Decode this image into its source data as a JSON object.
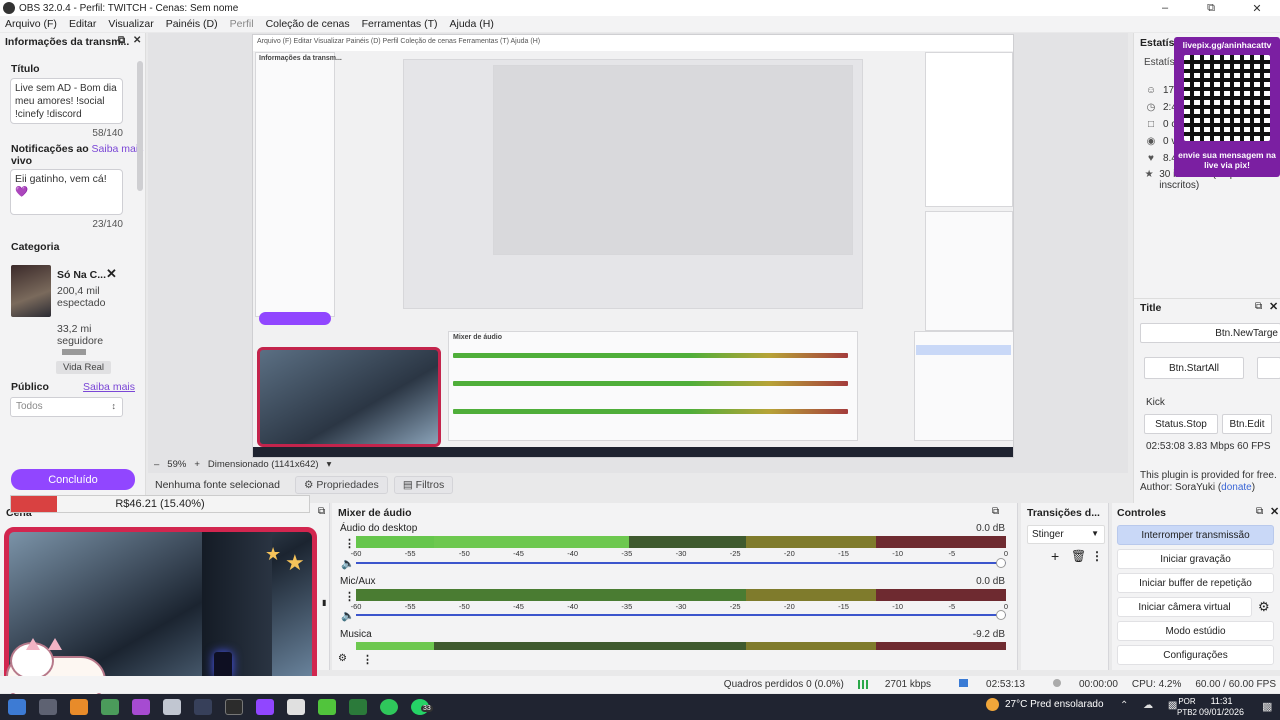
{
  "window": {
    "title": "OBS 32.0.4 - Perfil: TWITCH - Cenas: Sem nome"
  },
  "menu": [
    "Arquivo (F)",
    "Editar",
    "Visualizar",
    "Painéis (D)",
    "Perfil",
    "Coleção de cenas",
    "Ferramentas (T)",
    "Ajuda (H)"
  ],
  "left_dock": {
    "title": "Informações da transm...",
    "titulo_label": "Título",
    "titulo_value": "Live sem AD - Bom dia meu amores! !social !cinefy !discord",
    "titulo_count": "58/140",
    "notif_label": "Notificações ao",
    "notif_label2": "vivo",
    "notif_link": "Saiba mais",
    "notif_value": "Eii gatinho, vem cá! 💜",
    "notif_count": "23/140",
    "categoria_label": "Categoria",
    "cat_name": "Só Na C...",
    "cat_viewers": "200,4 mil",
    "cat_viewers_label": "espectado",
    "cat_followers": "33,2 mi",
    "cat_followers_label": "seguidore",
    "cat_tag": "Vida Real",
    "publico_label": "Público",
    "publico_link": "Saiba mais",
    "publico_value": "Todos",
    "done_label": "Concluído"
  },
  "donation": {
    "text": "R$46.21 (15.40%)",
    "percent": 15.4
  },
  "preview": {
    "zoom": "59%",
    "dimension": "Dimensionado (1141x642)"
  },
  "props_bar": {
    "no_source": "Nenhuma fonte selecionad",
    "properties": "Propriedades",
    "filters": "Filtros"
  },
  "right_dock": {
    "title": "Estatísti",
    "subtitle": "Estatís",
    "stats": [
      "17",
      "2:4",
      "0 c",
      "0 v",
      "8.4",
      "30 inscritos (45 pontos de inscritos)"
    ],
    "qr_top": "livepix.gg/aninhacattv",
    "qr_bottom": "envie sua mensagem na live via pix!",
    "title_dock": "Title",
    "btn_new_target": "Btn.NewTarge",
    "btn_start_all": "Btn.StartAll",
    "kick": "Kick",
    "status_stop": "Status.Stop",
    "btn_edit": "Btn.Edit",
    "kick_stats": "02:53:08  3.83 Mbps  60 FPS",
    "plugin_text": "This plugin is provided for free.",
    "author_prefix": "Author: SoraYuki (",
    "author_link": "donate",
    "author_suffix": ")"
  },
  "scenes": {
    "title": "Cena"
  },
  "mixer": {
    "title": "Mixer de áudio",
    "channels": [
      {
        "name": "Áudio do desktop",
        "db": "0.0 dB"
      },
      {
        "name": "Mic/Aux",
        "db": "0.0 dB"
      },
      {
        "name": "Musica",
        "db": "-9.2 dB"
      }
    ],
    "ticks": [
      "-60",
      "-55",
      "-50",
      "-45",
      "-40",
      "-35",
      "-30",
      "-25",
      "-20",
      "-15",
      "-10",
      "-5",
      "0"
    ]
  },
  "transitions": {
    "title": "Transições d...",
    "selected": "Stinger"
  },
  "controls": {
    "title": "Controles",
    "buttons": [
      "Interromper transmissão",
      "Iniciar gravação",
      "Iniciar buffer de repetição",
      "Iniciar câmera virtual",
      "Modo estúdio",
      "Configurações"
    ]
  },
  "status": {
    "dropped": "Quadros perdidos 0 (0.0%)",
    "bitrate": "2701 kbps",
    "stream_time": "02:53:13",
    "rec_time": "00:00:00",
    "cpu": "CPU: 4.2%",
    "fps": "60.00 / 60.00 FPS"
  },
  "taskbar": {
    "weather": "27°C  Pred ensolarado",
    "lang1": "POR",
    "lang2": "PTB2",
    "time": "11:31",
    "date": "09/01/2026",
    "badge": "33"
  },
  "colors": {
    "accent": "#9146ff",
    "stream_button": "#c9d8f7",
    "cam_frame": "#d2264f"
  }
}
